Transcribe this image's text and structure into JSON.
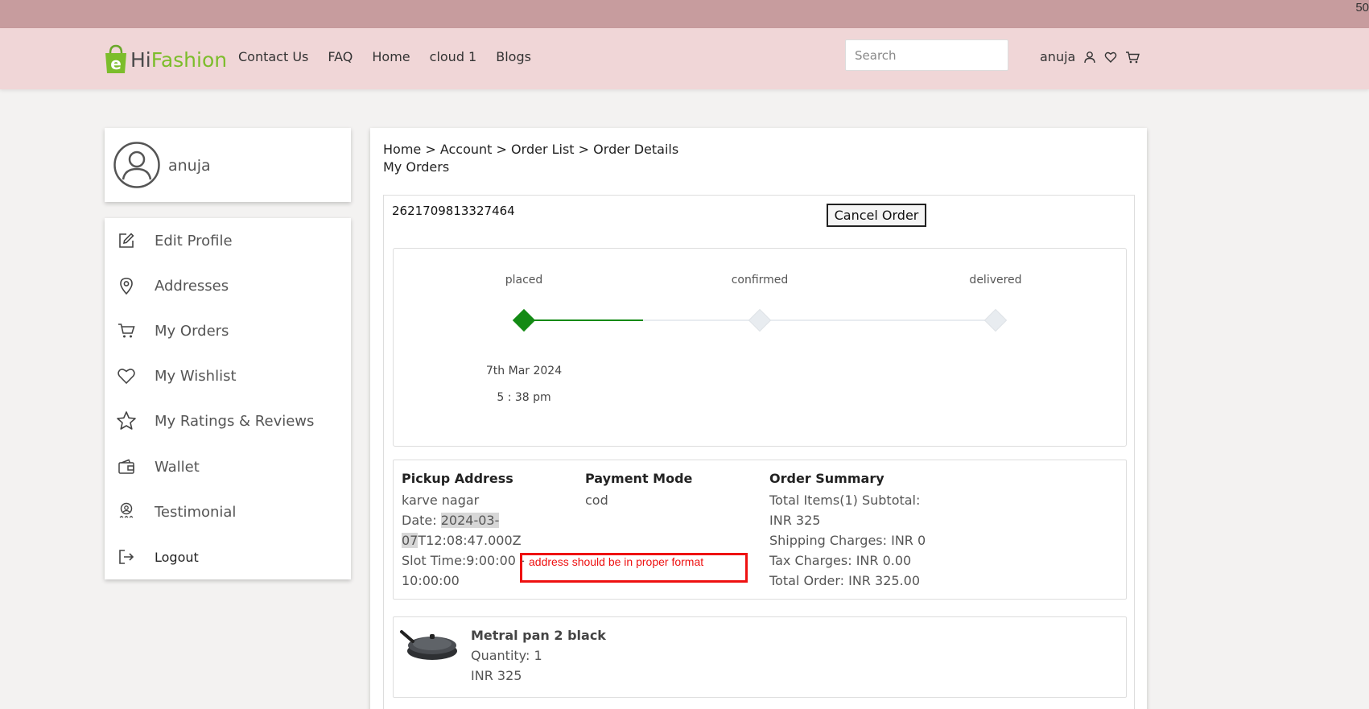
{
  "topstrip": {
    "counter": "50"
  },
  "header": {
    "logo": {
      "part1": "Hi",
      "part2": "Fashion"
    },
    "nav": [
      "Contact Us",
      "FAQ",
      "Home",
      "cloud 1",
      "Blogs"
    ],
    "search_placeholder": "Search",
    "username": "anuja"
  },
  "profile": {
    "name": "anuja"
  },
  "menu": [
    {
      "label": "Edit Profile",
      "icon": "edit-icon"
    },
    {
      "label": "Addresses",
      "icon": "location-pin-icon"
    },
    {
      "label": "My Orders",
      "icon": "cart-icon"
    },
    {
      "label": "My Wishlist",
      "icon": "heart-icon"
    },
    {
      "label": "My Ratings & Reviews",
      "icon": "star-icon"
    },
    {
      "label": "Wallet",
      "icon": "wallet-icon"
    },
    {
      "label": "Testimonial",
      "icon": "award-icon"
    },
    {
      "label": "Logout",
      "icon": "logout-icon"
    }
  ],
  "breadcrumb": [
    "Home",
    "Account",
    "Order List",
    "Order Details"
  ],
  "breadcrumb_sep": ">",
  "section_title": "My Orders",
  "order": {
    "id": "2621709813327464",
    "cancel_label": "Cancel Order",
    "stages": [
      {
        "label": "placed",
        "date": "7th Mar 2024",
        "time": "5 : 38 pm",
        "done": true
      },
      {
        "label": "confirmed",
        "done": false
      },
      {
        "label": "delivered",
        "done": false
      }
    ],
    "colors": {
      "done": "#138a14",
      "pending": "#e8ecf0"
    },
    "pickup": {
      "heading": "Pickup Address",
      "address": "karve nagar",
      "date_prefix": "Date: ",
      "date_highlight_1": "2024-03-",
      "date_highlight_2": "07",
      "date_rest": "T12:08:47.000Z",
      "slot_1": "Slot Time:9:00:00 -",
      "slot_2": "10:00:00"
    },
    "payment": {
      "heading": "Payment Mode",
      "value": "cod"
    },
    "summary": {
      "heading": "Order Summary",
      "line1": "Total Items(1) Subtotal:",
      "line2": "INR 325",
      "line3": "Shipping Charges: INR 0",
      "line4": "Tax Charges: INR 0.00",
      "line5": "Total Order: INR 325.00"
    },
    "annotation": "address should be in proper format",
    "product": {
      "name": "Metral pan 2 black",
      "quantity": "Quantity: 1",
      "price": "INR 325"
    }
  }
}
